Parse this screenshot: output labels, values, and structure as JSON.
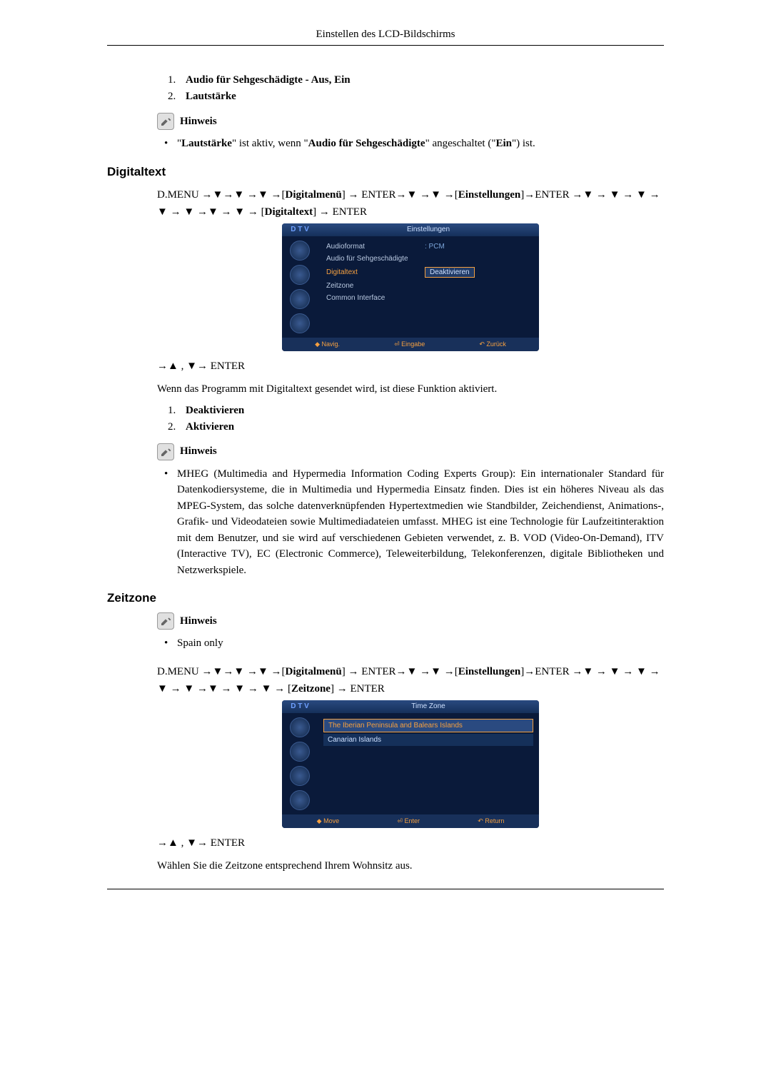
{
  "header": {
    "title": "Einstellen des LCD-Bildschirms"
  },
  "intro": {
    "ol": {
      "i1": "Audio für Sehgeschädigte - Aus, Ein",
      "i2": "Lautstärke"
    },
    "hinweis": "Hinweis",
    "bullet_pre": "\"",
    "bullet_b1": "Lautstärke",
    "bullet_mid": "\" ist aktiv, wenn \"",
    "bullet_b2": "Audio für Sehgeschädigte",
    "bullet_post": "\" angeschaltet (\"",
    "bullet_b3": "Ein",
    "bullet_end": "\") ist."
  },
  "digitaltext": {
    "heading": "Digitaltext",
    "nav1_a": "D.MENU →▼→▼ →▼ →[",
    "nav1_b": "Digitalmenü",
    "nav1_c": "] → ENTER→▼ →▼ →[",
    "nav1_d": "Einstellungen",
    "nav1_e": "]→ENTER →▼ → ▼ → ▼ → ▼ → ▼ →▼ → ▼ → [",
    "nav1_f": "Digitaltext",
    "nav1_g": "] → ENTER",
    "menu": {
      "dtv": "D T V",
      "title": "Einstellungen",
      "r1_lbl": "Audioformat",
      "r1_val": ": PCM",
      "r2_lbl": "Audio für Sehgeschädigte",
      "r3_lbl": "Digitaltext",
      "r3_val": "Deaktivieren",
      "r4_lbl": "Zeitzone",
      "r5_lbl": "Common Interface",
      "bot1": "◆ Navig.",
      "bot2": "⏎ Eingabe",
      "bot3": "↶ Zurück"
    },
    "nav2": "→▲ , ▼→ ENTER",
    "desc": "Wenn das Programm mit Digitaltext gesendet wird, ist diese Funktion aktiviert.",
    "ol": {
      "i1": "Deaktivieren",
      "i2": "Aktivieren"
    },
    "hinweis": "Hinweis",
    "bullet": "MHEG (Multimedia and Hypermedia Information Coding Experts Group): Ein internationaler Standard für Datenkodiersysteme, die in Multimedia und Hypermedia Einsatz finden. Dies ist ein höheres Niveau als das MPEG-System, das solche datenverknüpfenden Hypertextmedien wie Standbilder, Zeichendienst, Animations-, Grafik- und Videodateien sowie Multimediadateien umfasst. MHEG ist eine Technologie für Laufzeitinteraktion mit dem Benutzer, und sie wird auf verschiedenen Gebieten verwendet, z. B. VOD (Video-On-Demand), ITV (Interactive TV), EC (Electronic Commerce), Teleweiterbildung, Telekonferenzen, digitale Bibliotheken und Netzwerkspiele."
  },
  "zeitzone": {
    "heading": "Zeitzone",
    "hinweis": "Hinweis",
    "bullet": "Spain only",
    "nav1_a": "D.MENU →▼→▼ →▼ →[",
    "nav1_b": "Digitalmenü",
    "nav1_c": "] → ENTER→▼ →▼ →[",
    "nav1_d": "Einstellungen",
    "nav1_e": "]→ENTER →▼ → ▼ → ▼ → ▼ → ▼ →▼ → ▼ → ▼ → [",
    "nav1_f": "Zeitzone",
    "nav1_g": "] → ENTER",
    "menu": {
      "dtv": "D T V",
      "title": "Time Zone",
      "item1": "The Iberian Peninsula and Balears Islands",
      "item2": "Canarian Islands",
      "bot1": "◆ Move",
      "bot2": "⏎ Enter",
      "bot3": "↶ Return"
    },
    "nav2": "→▲ , ▼→ ENTER",
    "desc": "Wählen Sie die Zeitzone entsprechend Ihrem Wohnsitz aus."
  }
}
